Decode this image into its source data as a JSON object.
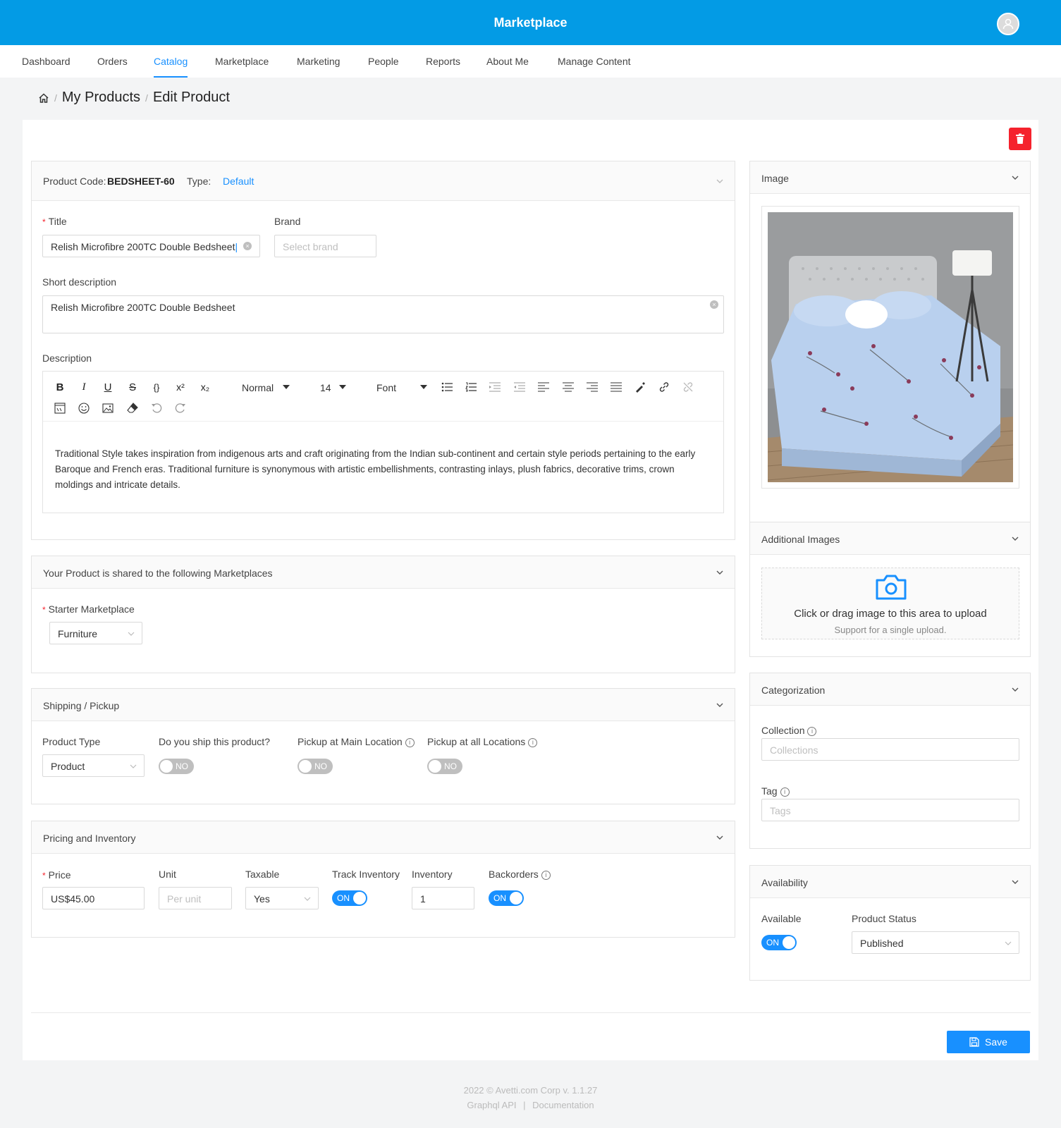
{
  "app": {
    "title": "Marketplace"
  },
  "nav": [
    {
      "label": "Dashboard"
    },
    {
      "label": "Orders"
    },
    {
      "label": "Catalog"
    },
    {
      "label": "Marketplace"
    },
    {
      "label": "Marketing"
    },
    {
      "label": "People"
    },
    {
      "label": "Reports"
    },
    {
      "label": "About Me"
    },
    {
      "label": "Manage Content"
    }
  ],
  "breadcrumb": {
    "sep": "/",
    "parent": "My Products",
    "current": "Edit Product"
  },
  "product_card": {
    "code_label": "Product Code:",
    "code_value": "BEDSHEET-60",
    "type_label": "Type:",
    "type_value": "Default",
    "title_label": "Title",
    "title_value": "Relish Microfibre 200TC Double Bedsheet",
    "brand_label": "Brand",
    "brand_placeholder": "Select brand",
    "short_desc_label": "Short description",
    "short_desc_value": "Relish Microfibre 200TC Double Bedsheet",
    "desc_label": "Description",
    "toolbar": {
      "heading": "Normal",
      "size": "14",
      "font": "Font"
    },
    "description_text": "Traditional Style takes inspiration from indigenous arts and craft originating from the Indian sub-continent and certain style periods pertaining to the early Baroque and French eras. Traditional furniture is synonymous with artistic embellishments, contrasting inlays, plush fabrics, decorative trims, crown moldings and intricate details."
  },
  "marketplaces": {
    "header": "Your Product is shared to the following Marketplaces",
    "label": "Starter Marketplace",
    "value": "Furniture"
  },
  "shipping": {
    "header": "Shipping / Pickup",
    "product_type_label": "Product Type",
    "product_type_value": "Product",
    "ship_label": "Do you ship this product?",
    "ship_state": "NO",
    "pickup_main_label": "Pickup at Main Location",
    "pickup_main_state": "NO",
    "pickup_all_label": "Pickup at all Locations",
    "pickup_all_state": "NO"
  },
  "pricing": {
    "header": "Pricing and Inventory",
    "price_label": "Price",
    "price_value": "US$45.00",
    "unit_label": "Unit",
    "unit_placeholder": "Per unit",
    "taxable_label": "Taxable",
    "taxable_value": "Yes",
    "track_label": "Track Inventory",
    "track_state": "ON",
    "inventory_label": "Inventory",
    "inventory_value": "1",
    "backorders_label": "Backorders",
    "backorders_state": "ON"
  },
  "image_card": {
    "header": "Image"
  },
  "additional_images": {
    "header": "Additional Images",
    "upload_text": "Click or drag image to this area to upload",
    "upload_hint": "Support for a single upload."
  },
  "categorization": {
    "header": "Categorization",
    "collection_label": "Collection",
    "collection_placeholder": "Collections",
    "tag_label": "Tag",
    "tag_placeholder": "Tags"
  },
  "availability": {
    "header": "Availability",
    "available_label": "Available",
    "available_state": "ON",
    "status_label": "Product Status",
    "status_value": "Published"
  },
  "actions": {
    "save_label": "Save"
  },
  "footer": {
    "line1": "2022 © Avetti.com Corp v. 1.1.27",
    "api_link": "Graphql API",
    "divider": "|",
    "docs_link": "Documentation"
  },
  "colors": {
    "primary": "#1890ff",
    "header": "#039be5",
    "danger": "#f5222d"
  }
}
